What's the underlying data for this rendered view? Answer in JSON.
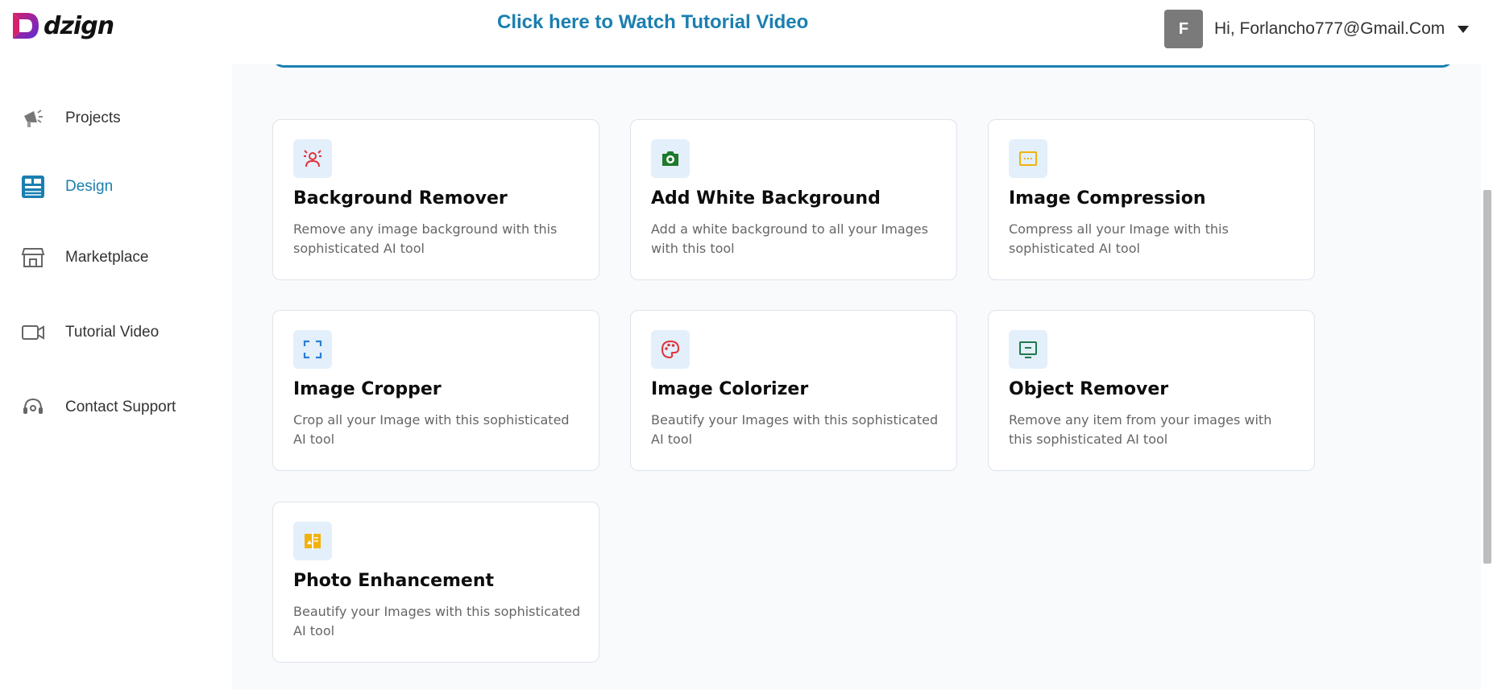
{
  "header": {
    "logo_text": "dzign",
    "tutorial_link": "Click here to Watch Tutorial Video",
    "avatar_initial": "F",
    "greeting": "Hi, Forlancho777@Gmail.Com"
  },
  "sidebar": {
    "items": [
      {
        "label": "Projects",
        "icon": "megaphone-icon"
      },
      {
        "label": "Design",
        "icon": "design-icon",
        "active": true
      },
      {
        "label": "Marketplace",
        "icon": "store-icon"
      },
      {
        "label": "Tutorial Video",
        "icon": "video-camera-icon"
      },
      {
        "label": "Contact Support",
        "icon": "headset-icon"
      }
    ]
  },
  "tools": [
    {
      "title": "Background Remover",
      "desc": "Remove any image background with this sophisticated AI tool",
      "icon": "person-remove-icon",
      "icon_color": "#e0323c"
    },
    {
      "title": "Add White Background",
      "desc": "Add a white background to all your Images with this tool",
      "icon": "camera-icon",
      "icon_color": "#1e7a2d"
    },
    {
      "title": "Image Compression",
      "desc": "Compress all your Image with this sophisticated AI tool",
      "icon": "compress-icon",
      "icon_color": "#f2b20d"
    },
    {
      "title": "Image Cropper",
      "desc": "Crop all your Image with this sophisticated AI tool",
      "icon": "crop-icon",
      "icon_color": "#2a7fd4"
    },
    {
      "title": "Image Colorizer",
      "desc": "Beautify your Images with this sophisticated AI tool",
      "icon": "palette-icon",
      "icon_color": "#e0323c"
    },
    {
      "title": "Object Remover",
      "desc": "Remove any item from your images with this sophisticated AI tool",
      "icon": "monitor-icon",
      "icon_color": "#1e7a4d"
    },
    {
      "title": "Photo Enhancement",
      "desc": "Beautify your Images with this sophisticated AI tool",
      "icon": "enhance-icon",
      "icon_color": "#f2b20d"
    }
  ],
  "colors": {
    "accent": "#1a7fb0",
    "logo_gradient_start": "#d6216b",
    "logo_gradient_end": "#5a2bd6"
  }
}
